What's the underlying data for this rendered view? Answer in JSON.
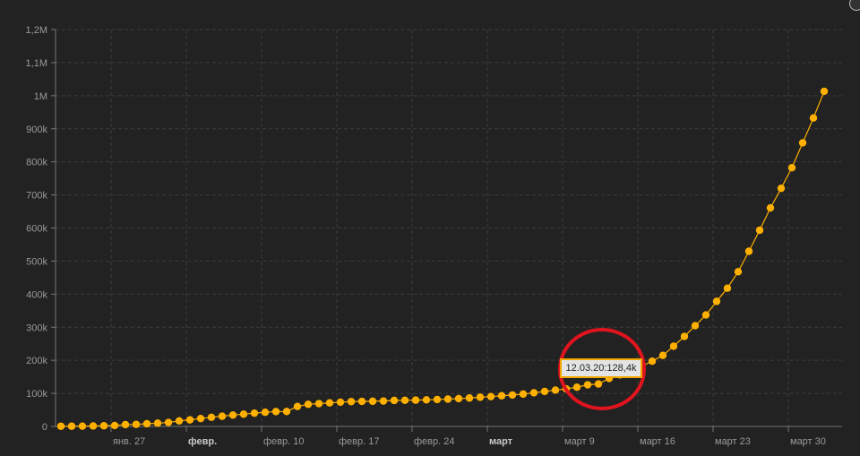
{
  "chart_data": {
    "type": "line",
    "title": "",
    "xlabel": "",
    "ylabel": "",
    "start_date": "2020-01-22",
    "values_k": [
      0.6,
      0.7,
      0.9,
      1.4,
      2.1,
      2.9,
      5.6,
      6.2,
      8.2,
      9.9,
      12.0,
      16.8,
      19.9,
      23.9,
      27.6,
      30.8,
      34.4,
      37.1,
      40.2,
      42.8,
      44.8,
      45.2,
      60.4,
      66.9,
      69.0,
      71.2,
      73.3,
      75.1,
      75.6,
      76.2,
      76.8,
      78.6,
      79.0,
      79.6,
      80.4,
      81.4,
      82.7,
      84.1,
      86.0,
      88.4,
      90.3,
      92.8,
      95.1,
      97.9,
      101.8,
      105.8,
      109.8,
      113.6,
      118.6,
      125.9,
      128.4,
      145.2,
      156.1,
      167.4,
      181.5,
      197.2,
      214.9,
      242.7,
      272.2,
      304.5,
      337.0,
      378.2,
      418.0,
      467.7,
      529.6,
      593.3,
      660.7,
      720.1,
      782.4,
      857.5,
      932.6,
      1013.2
    ],
    "ylim_k": [
      0,
      1200
    ],
    "y_ticks": [
      {
        "v": 0,
        "label": "0"
      },
      {
        "v": 100,
        "label": "100k"
      },
      {
        "v": 200,
        "label": "200k"
      },
      {
        "v": 300,
        "label": "300k"
      },
      {
        "v": 400,
        "label": "400k"
      },
      {
        "v": 500,
        "label": "500k"
      },
      {
        "v": 600,
        "label": "600k"
      },
      {
        "v": 700,
        "label": "700k"
      },
      {
        "v": 800,
        "label": "800k"
      },
      {
        "v": 900,
        "label": "900k"
      },
      {
        "v": 1000,
        "label": "1M"
      },
      {
        "v": 1100,
        "label": "1,1M"
      },
      {
        "v": 1200,
        "label": "1,2M"
      }
    ],
    "x_ticks": [
      {
        "day": 5,
        "label": "янв. 27",
        "bold": false
      },
      {
        "day": 12,
        "label": "февр.",
        "bold": true
      },
      {
        "day": 19,
        "label": "февр. 10",
        "bold": false
      },
      {
        "day": 26,
        "label": "февр. 17",
        "bold": false
      },
      {
        "day": 33,
        "label": "февр. 24",
        "bold": false
      },
      {
        "day": 40,
        "label": "март",
        "bold": true
      },
      {
        "day": 47,
        "label": "март 9",
        "bold": false
      },
      {
        "day": 54,
        "label": "март 16",
        "bold": false
      },
      {
        "day": 61,
        "label": "март 23",
        "bold": false
      },
      {
        "day": 68,
        "label": "март 30",
        "bold": false
      }
    ],
    "grid": true,
    "series_color": "#ffb000",
    "highlight_color": "#e0141e",
    "tooltip": {
      "day": 50,
      "text": "12.03.20:128,4k"
    }
  }
}
